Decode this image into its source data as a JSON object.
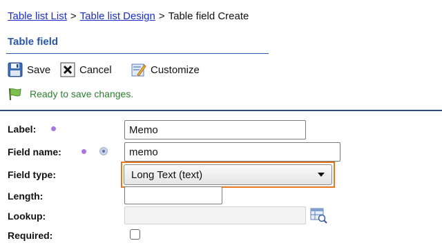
{
  "breadcrumb": {
    "items": [
      "Table list List",
      "Table list Design"
    ],
    "current": "Table field Create",
    "separator": ">"
  },
  "section": {
    "title": "Table field"
  },
  "toolbar": {
    "save_label": "Save",
    "cancel_label": "Cancel",
    "customize_label": "Customize"
  },
  "status": {
    "message": "Ready to save changes."
  },
  "form": {
    "label": {
      "label": "Label:",
      "value": "Memo"
    },
    "field_name": {
      "label": "Field name:",
      "value": "memo"
    },
    "field_type": {
      "label": "Field type:",
      "value": "Long Text (text)"
    },
    "length": {
      "label": "Length:",
      "value": ""
    },
    "lookup": {
      "label": "Lookup:",
      "value": ""
    },
    "required": {
      "label": "Required:",
      "checked": false
    }
  },
  "colors": {
    "link": "#1a2fc8",
    "section_title": "#2a56a6",
    "status_text": "#2e7d2e",
    "focus_highlight": "#e8761f",
    "mandatory_dot": "#a877e0"
  },
  "icons": {
    "save": "floppy-disk-icon",
    "cancel": "x-box-icon",
    "customize": "edit-form-icon",
    "status": "green-flag-icon",
    "lookup": "lookup-table-icon"
  }
}
